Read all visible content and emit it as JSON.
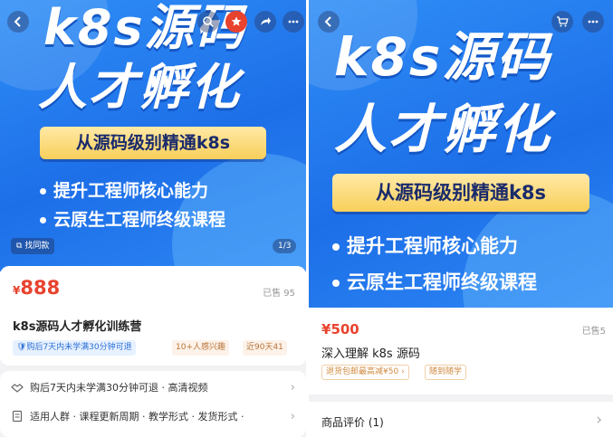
{
  "left": {
    "banner": {
      "headline_1": "k8s源码",
      "headline_2": "人才孵化",
      "tagline": "从源码级别精通k8s",
      "bullet_1": "提升工程师核心能力",
      "bullet_2": "云原生工程师终级课程",
      "find_similar": "找同款",
      "page_indicator": "1/3"
    },
    "product": {
      "currency": "¥",
      "price": "888",
      "sold": "已售 95",
      "title": "k8s源码人才孵化训练营",
      "tag_guarantee": "购后7天内未学满30分钟可退",
      "tag_interest": "10+人感兴趣",
      "tag_recent": "近90天41"
    },
    "service_rows": [
      {
        "text": "购后7天内未学满30分钟可退 · 高清视频"
      },
      {
        "text": "适用人群 · 课程更新周期 · 教学形式 · 发货形式 ·"
      }
    ]
  },
  "right": {
    "banner": {
      "headline_1": "k8s源码",
      "headline_2": "人才孵化",
      "tagline": "从源码级别精通k8s",
      "bullet_1": "提升工程师核心能力",
      "bullet_2": "云原生工程师终级课程"
    },
    "product": {
      "currency": "¥",
      "price": "500",
      "sold": "已售5",
      "title": "深入理解 k8s 源码",
      "tag_1": "退货包邮最高减¥50 ›",
      "tag_2": "随到随学"
    },
    "reviews": {
      "label": "商品评价 (1)"
    }
  },
  "colors": {
    "accent_red": "#e8432e",
    "banner_blue": "#1d6fe8",
    "tagline_gold": "#f8cf5a"
  }
}
